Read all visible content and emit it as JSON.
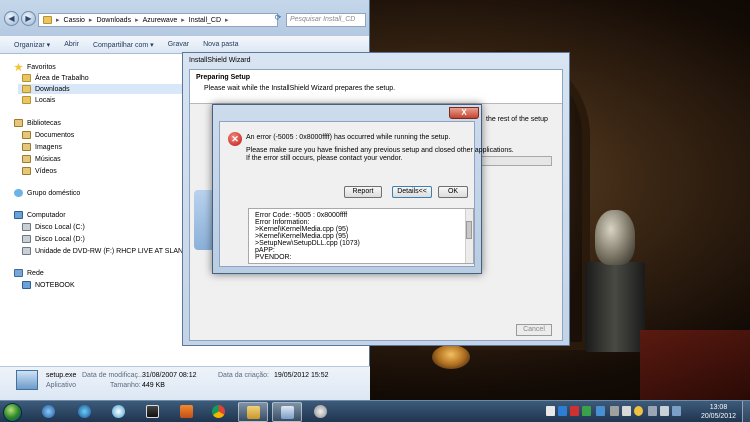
{
  "explorer": {
    "breadcrumb": [
      "Cassio",
      "Downloads",
      "Azurewave",
      "Install_CD"
    ],
    "search_placeholder": "Pesquisar Install_CD",
    "toolbar": [
      "Organizar ▾",
      "Abrir",
      "Compartilhar com ▾",
      "Gravar",
      "Nova pasta"
    ],
    "nav": {
      "favorites": "Favoritos",
      "fav_items": [
        "Área de Trabalho",
        "Downloads",
        "Locais"
      ],
      "libraries": "Bibliotecas",
      "lib_items": [
        "Documentos",
        "Imagens",
        "Músicas",
        "Vídeos"
      ],
      "homegroup": "Grupo doméstico",
      "computer": "Computador",
      "drives": [
        "Disco Local (C:)",
        "Disco Local (D:)",
        "Unidade de DVD-RW (F:) RHCP LIVE AT SLANE CAST"
      ],
      "network": "Rede",
      "net_items": [
        "NOTEBOOK"
      ]
    },
    "details": {
      "name": "setup.exe",
      "type": "Aplicativo",
      "modified_label": "Data de modificaç...",
      "modified_value": "31/08/2007 08:12",
      "size_label": "Tamanho:",
      "size_value": "449 KB",
      "created_label": "Data da criação:",
      "created_value": "19/05/2012 15:52"
    }
  },
  "installshield": {
    "title": "InstallShield Wizard",
    "heading": "Preparing Setup",
    "subheading": "Please wait while the InstallShield Wizard prepares the setup.",
    "partial_text": "the rest of the setup",
    "cancel": "Cancel"
  },
  "error_dialog": {
    "close": "X",
    "message1": "An error (-5005 : 0x8000ffff) has occurred while running the setup.",
    "message2": "Please make sure you have finished any previous setup and closed other applications.",
    "message3": "If the error still occurs, please contact your vendor.",
    "buttons": {
      "report": "Report",
      "details": "Details<<",
      "ok": "OK"
    },
    "details_lines": [
      "Error Code:            -5005 : 0x8000ffff",
      "Error Information:",
      ">Kernel\\KernelMedia.cpp (95)",
      ">Kernel\\KernelMedia.cpp (95)",
      ">SetupNew\\SetupDLL.cpp (1073)",
      "pAPP:",
      "PVENDOR:"
    ]
  },
  "taskbar": {
    "time": "13:08",
    "date": "20/05/2012"
  }
}
